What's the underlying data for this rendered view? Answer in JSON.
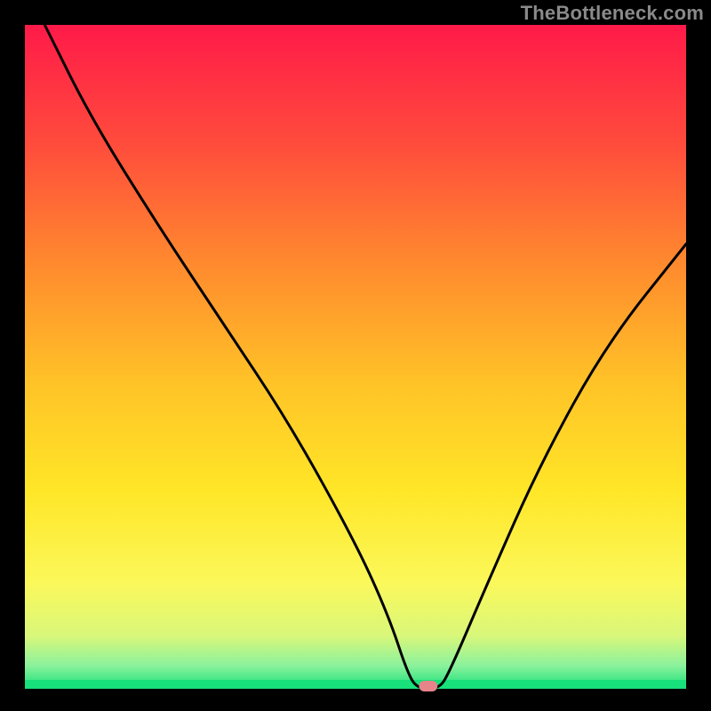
{
  "watermark": "TheBottleneck.com",
  "chart_data": {
    "type": "line",
    "title": "",
    "xlabel": "",
    "ylabel": "",
    "xlim": [
      0,
      100
    ],
    "ylim": [
      0,
      100
    ],
    "annotations": [],
    "background_gradient_stops": [
      {
        "offset": 0,
        "color": "#ff1a49"
      },
      {
        "offset": 0.18,
        "color": "#ff4c3c"
      },
      {
        "offset": 0.36,
        "color": "#ff8a2e"
      },
      {
        "offset": 0.54,
        "color": "#ffc327"
      },
      {
        "offset": 0.7,
        "color": "#ffe627"
      },
      {
        "offset": 0.84,
        "color": "#fbf85a"
      },
      {
        "offset": 0.92,
        "color": "#d9f77a"
      },
      {
        "offset": 0.965,
        "color": "#8bf29c"
      },
      {
        "offset": 1.0,
        "color": "#18e07a"
      }
    ],
    "bottom_band_color": "#18e07a",
    "series": [
      {
        "name": "bottleneck-curve",
        "color": "#000000",
        "values": [
          {
            "x": 3.0,
            "y": 100.0
          },
          {
            "x": 10.0,
            "y": 86.0
          },
          {
            "x": 20.0,
            "y": 70.0
          },
          {
            "x": 30.0,
            "y": 55.0
          },
          {
            "x": 40.0,
            "y": 40.0
          },
          {
            "x": 50.0,
            "y": 22.0
          },
          {
            "x": 55.0,
            "y": 11.0
          },
          {
            "x": 58.0,
            "y": 2.0
          },
          {
            "x": 59.5,
            "y": 0.0
          },
          {
            "x": 62.5,
            "y": 0.0
          },
          {
            "x": 64.0,
            "y": 2.0
          },
          {
            "x": 70.0,
            "y": 16.0
          },
          {
            "x": 78.0,
            "y": 34.0
          },
          {
            "x": 88.0,
            "y": 52.0
          },
          {
            "x": 100.0,
            "y": 67.0
          }
        ]
      }
    ],
    "minimum_marker": {
      "shape": "rounded-rect",
      "x": 61.0,
      "y": 0.0,
      "width_pct": 2.8,
      "height_pct": 1.6,
      "fill": "#e7848a"
    }
  }
}
